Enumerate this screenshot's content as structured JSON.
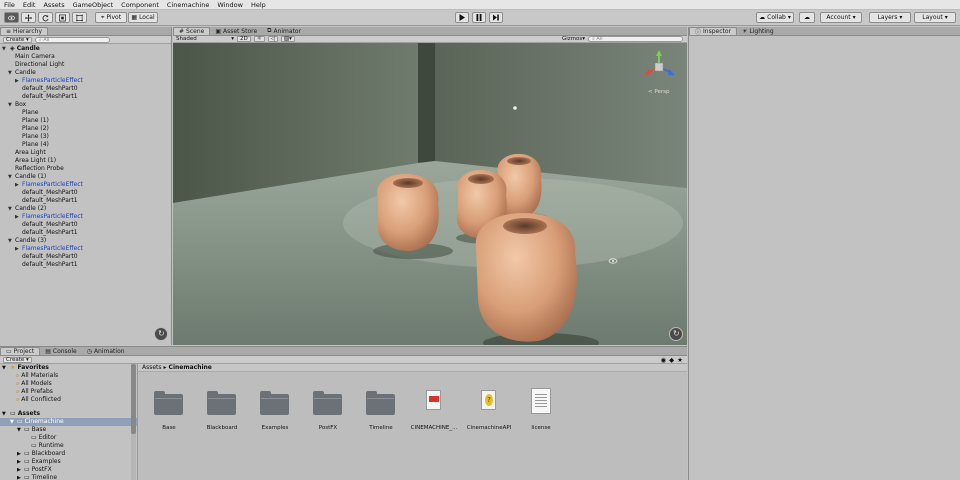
{
  "menu": [
    "File",
    "Edit",
    "Assets",
    "GameObject",
    "Component",
    "Cinemachine",
    "Window",
    "Help"
  ],
  "toolbar": {
    "pivot": "Pivot",
    "local": "Local",
    "collab": "Collab",
    "account": "Account",
    "layers": "Layers",
    "layout": "Layout"
  },
  "hierarchy": {
    "tab": "Hierarchy",
    "create": "Create",
    "search_placeholder": "All",
    "scene": "Candle",
    "rows": [
      {
        "label": "Main Camera",
        "indent": 1,
        "arrow": false,
        "blue": false
      },
      {
        "label": "Directional Light",
        "indent": 1,
        "arrow": false,
        "blue": false
      },
      {
        "label": "Candle",
        "indent": 1,
        "arrow": true,
        "blue": false
      },
      {
        "label": "FlamesParticleEffect",
        "indent": 2,
        "arrow": true,
        "blue": true
      },
      {
        "label": "default_MeshPart0",
        "indent": 2,
        "arrow": false,
        "blue": false
      },
      {
        "label": "default_MeshPart1",
        "indent": 2,
        "arrow": false,
        "blue": false
      },
      {
        "label": "Box",
        "indent": 1,
        "arrow": true,
        "blue": false
      },
      {
        "label": "Plane",
        "indent": 2,
        "arrow": false,
        "blue": false
      },
      {
        "label": "Plane (1)",
        "indent": 2,
        "arrow": false,
        "blue": false
      },
      {
        "label": "Plane (2)",
        "indent": 2,
        "arrow": false,
        "blue": false
      },
      {
        "label": "Plane (3)",
        "indent": 2,
        "arrow": false,
        "blue": false
      },
      {
        "label": "Plane (4)",
        "indent": 2,
        "arrow": false,
        "blue": false
      },
      {
        "label": "Area Light",
        "indent": 1,
        "arrow": false,
        "blue": false
      },
      {
        "label": "Area Light (1)",
        "indent": 1,
        "arrow": false,
        "blue": false
      },
      {
        "label": "Reflection Probe",
        "indent": 1,
        "arrow": false,
        "blue": false
      },
      {
        "label": "Candle (1)",
        "indent": 1,
        "arrow": true,
        "blue": false
      },
      {
        "label": "FlamesParticleEffect",
        "indent": 2,
        "arrow": true,
        "blue": true
      },
      {
        "label": "default_MeshPart0",
        "indent": 2,
        "arrow": false,
        "blue": false
      },
      {
        "label": "default_MeshPart1",
        "indent": 2,
        "arrow": false,
        "blue": false
      },
      {
        "label": "Candle (2)",
        "indent": 1,
        "arrow": true,
        "blue": false
      },
      {
        "label": "FlamesParticleEffect",
        "indent": 2,
        "arrow": true,
        "blue": true
      },
      {
        "label": "default_MeshPart0",
        "indent": 2,
        "arrow": false,
        "blue": false
      },
      {
        "label": "default_MeshPart1",
        "indent": 2,
        "arrow": false,
        "blue": false
      },
      {
        "label": "Candle (3)",
        "indent": 1,
        "arrow": true,
        "blue": false
      },
      {
        "label": "FlamesParticleEffect",
        "indent": 2,
        "arrow": true,
        "blue": true
      },
      {
        "label": "default_MeshPart0",
        "indent": 2,
        "arrow": false,
        "blue": false
      },
      {
        "label": "default_MeshPart1",
        "indent": 2,
        "arrow": false,
        "blue": false
      }
    ]
  },
  "scene": {
    "tabs": [
      "Scene",
      "Asset Store",
      "Animator"
    ],
    "shading": "Shaded",
    "mode2d": "2D",
    "gizmos": "Gizmos",
    "search_placeholder": "All",
    "persp": "< Persp"
  },
  "inspector": {
    "tabs": [
      "Inspector",
      "Lighting"
    ]
  },
  "project": {
    "tabs": [
      "Project",
      "Console",
      "Animation"
    ],
    "create": "Create",
    "breadcrumb_root": "Assets",
    "breadcrumb_current": "Cinemachine",
    "favorites_label": "Favorites",
    "favorites": [
      "All Materials",
      "All Models",
      "All Prefabs",
      "All Conflicted"
    ],
    "assets_label": "Assets",
    "tree": [
      {
        "label": "Cinemachine",
        "indent": 1,
        "selected": true
      },
      {
        "label": "Base",
        "indent": 2,
        "selected": false
      },
      {
        "label": "Editor",
        "indent": 3,
        "selected": false
      },
      {
        "label": "Runtime",
        "indent": 3,
        "selected": false
      },
      {
        "label": "Blackboard",
        "indent": 2,
        "selected": false
      },
      {
        "label": "Examples",
        "indent": 2,
        "selected": false
      },
      {
        "label": "PostFX",
        "indent": 2,
        "selected": false
      },
      {
        "label": "Timeline",
        "indent": 2,
        "selected": false
      }
    ],
    "items": [
      {
        "label": "Base",
        "kind": "folder"
      },
      {
        "label": "Blackboard",
        "kind": "folder"
      },
      {
        "label": "Examples",
        "kind": "folder"
      },
      {
        "label": "PostFX",
        "kind": "folder"
      },
      {
        "label": "Timeline",
        "kind": "folder"
      },
      {
        "label": "CINEMACHINE_...",
        "kind": "pdf"
      },
      {
        "label": "CinemachineAPI",
        "kind": "doc"
      },
      {
        "label": "license",
        "kind": "text"
      }
    ]
  },
  "colors": {
    "panel": "#c2c2c2",
    "selection": "#8fa0b8",
    "prefab_blue": "#1a3fbf"
  }
}
